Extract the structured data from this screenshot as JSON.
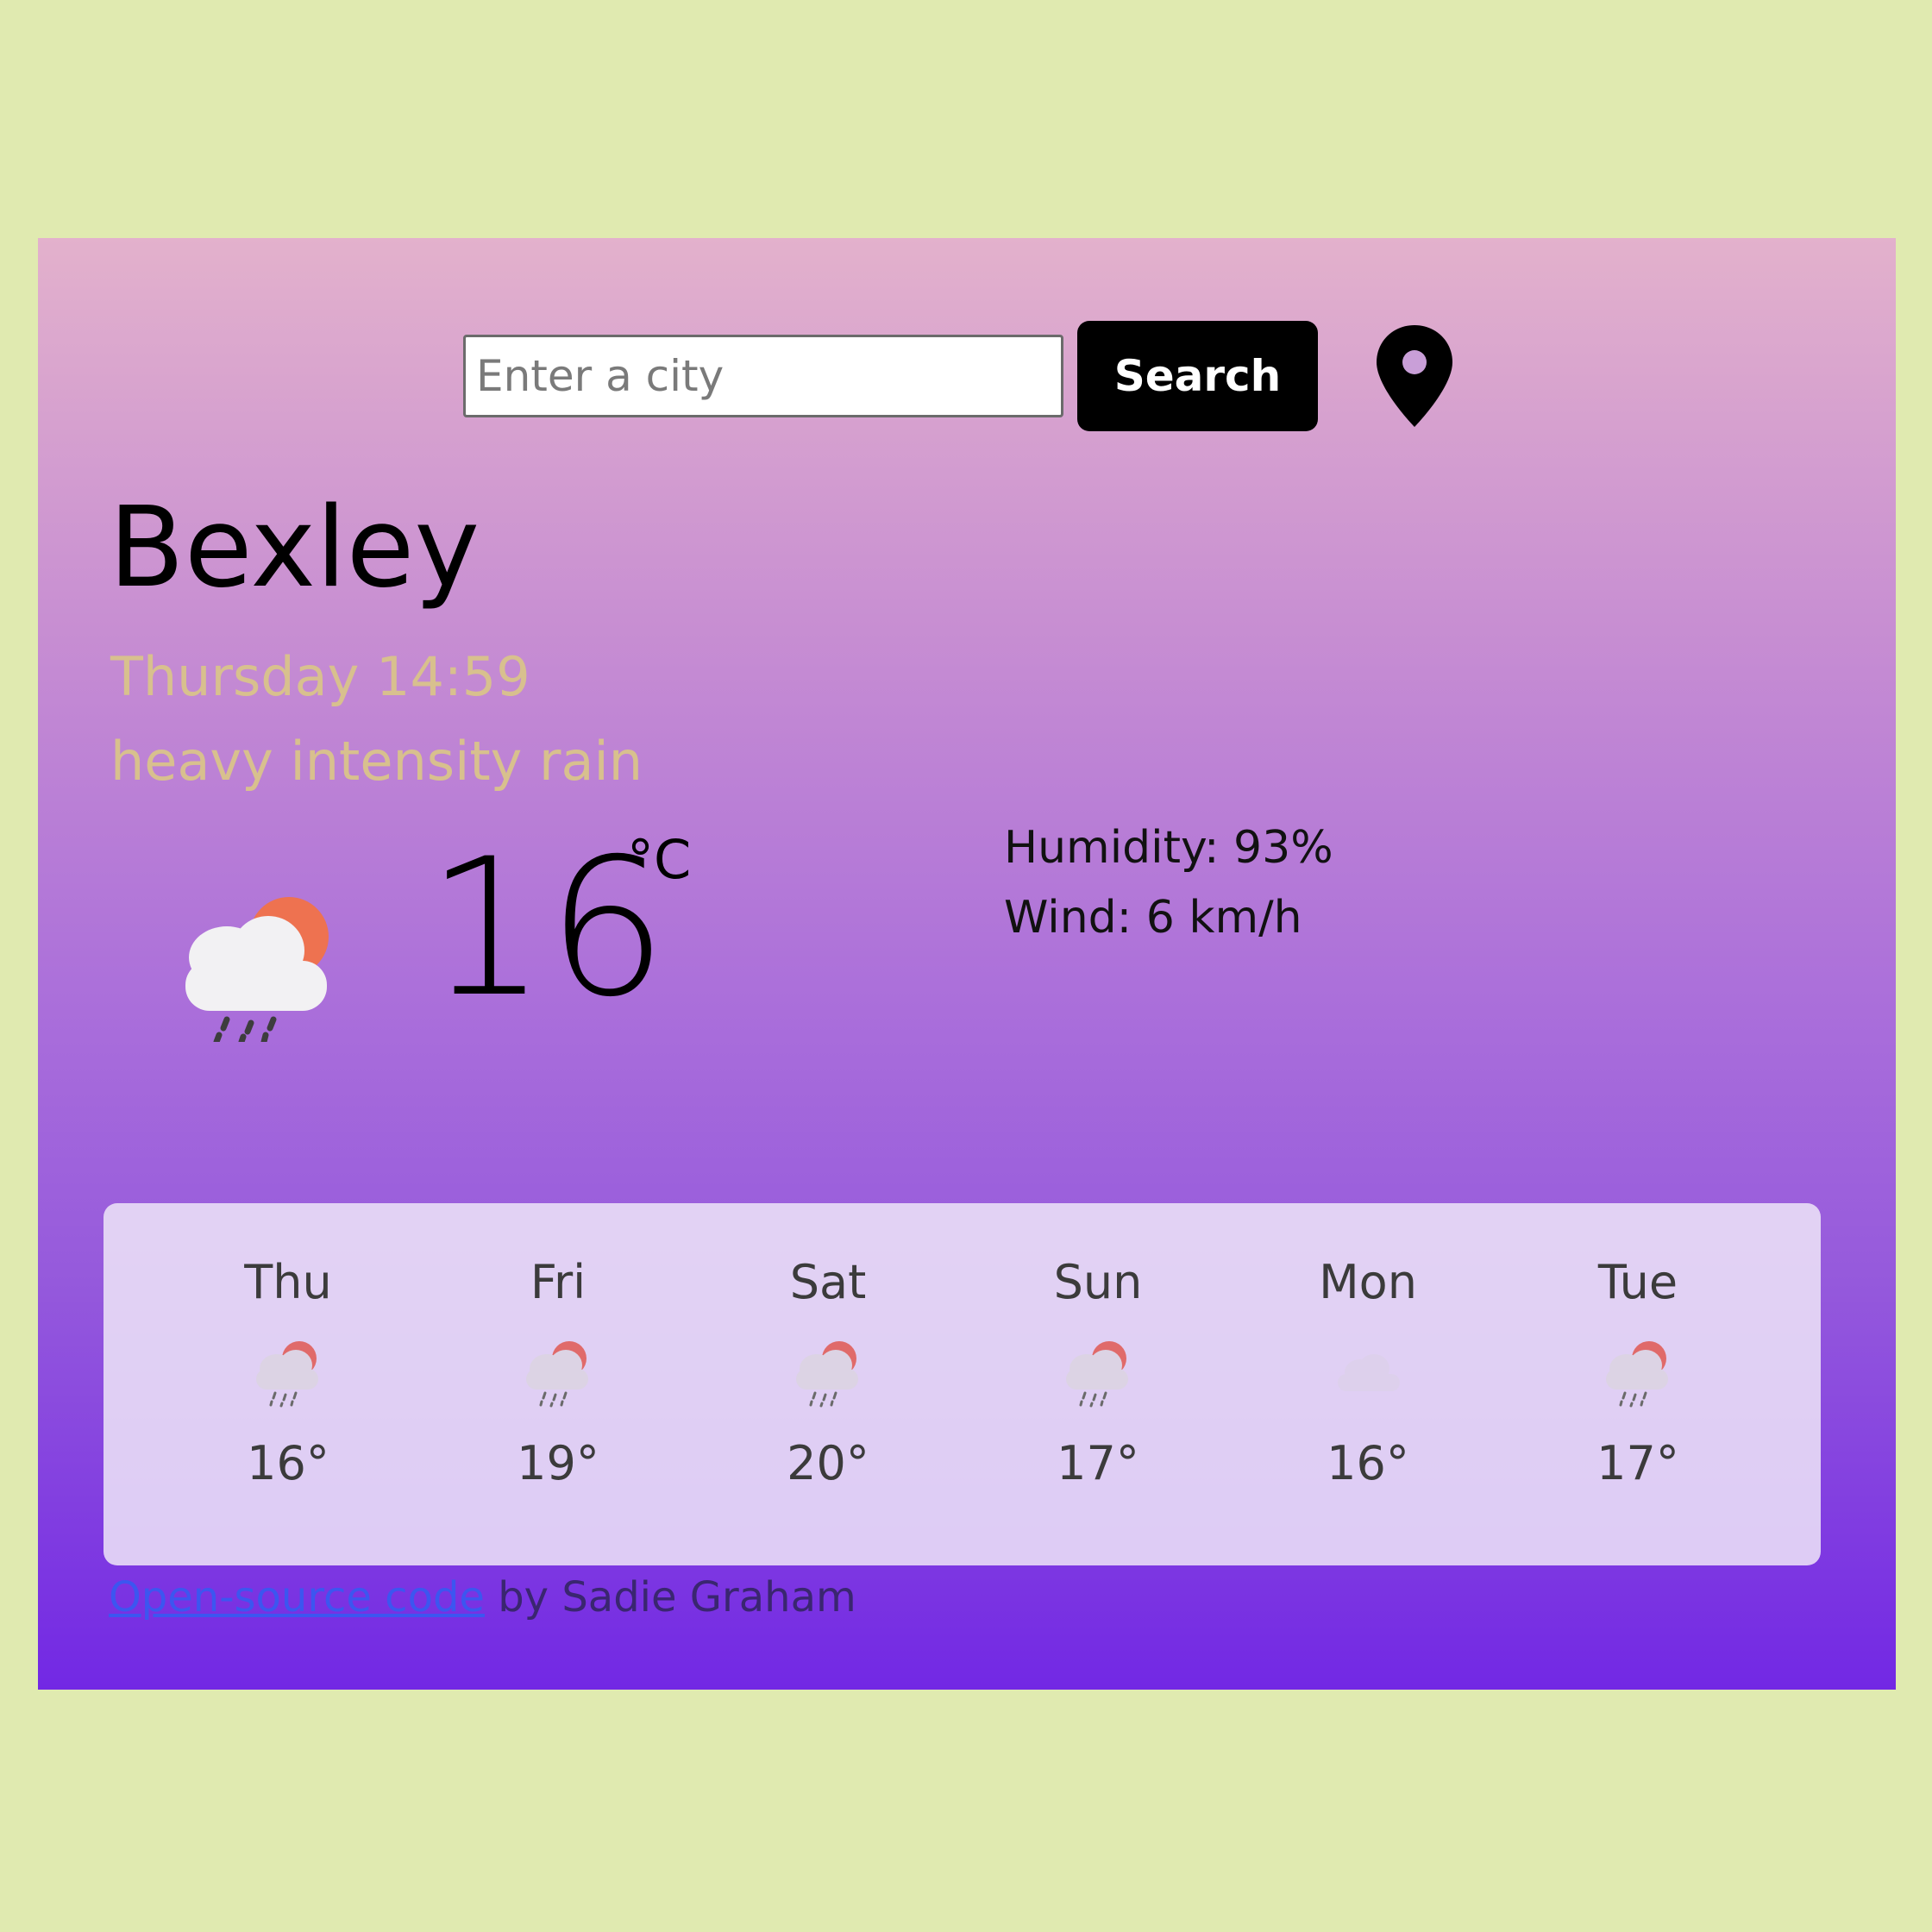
{
  "search": {
    "placeholder": "Enter a city",
    "value": "",
    "button_label": "Search"
  },
  "current": {
    "city": "Bexley",
    "datetime": "Thursday 14:59",
    "description": "heavy intensity rain",
    "temperature": "16",
    "unit": "°C",
    "humidity": "Humidity: 93%",
    "wind": "Wind: 6 km/h",
    "icon": "rain-cloud-sun-icon"
  },
  "forecast": [
    {
      "day": "Thu",
      "temp": "16°",
      "icon": "rain-cloud-sun-icon"
    },
    {
      "day": "Fri",
      "temp": "19°",
      "icon": "rain-cloud-sun-icon"
    },
    {
      "day": "Sat",
      "temp": "20°",
      "icon": "rain-cloud-sun-icon"
    },
    {
      "day": "Sun",
      "temp": "17°",
      "icon": "rain-cloud-sun-icon"
    },
    {
      "day": "Mon",
      "temp": "16°",
      "icon": "cloud-icon"
    },
    {
      "day": "Tue",
      "temp": "17°",
      "icon": "rain-cloud-sun-icon"
    }
  ],
  "footer": {
    "link_text": "Open-source code",
    "byline": " by Sadie Graham"
  },
  "colors": {
    "page_background": "#e0eab0",
    "accent_text": "#d8c08e",
    "sun": "#ee7250",
    "gradient_top": "#e3b1cc",
    "gradient_bottom": "#7228e4"
  }
}
